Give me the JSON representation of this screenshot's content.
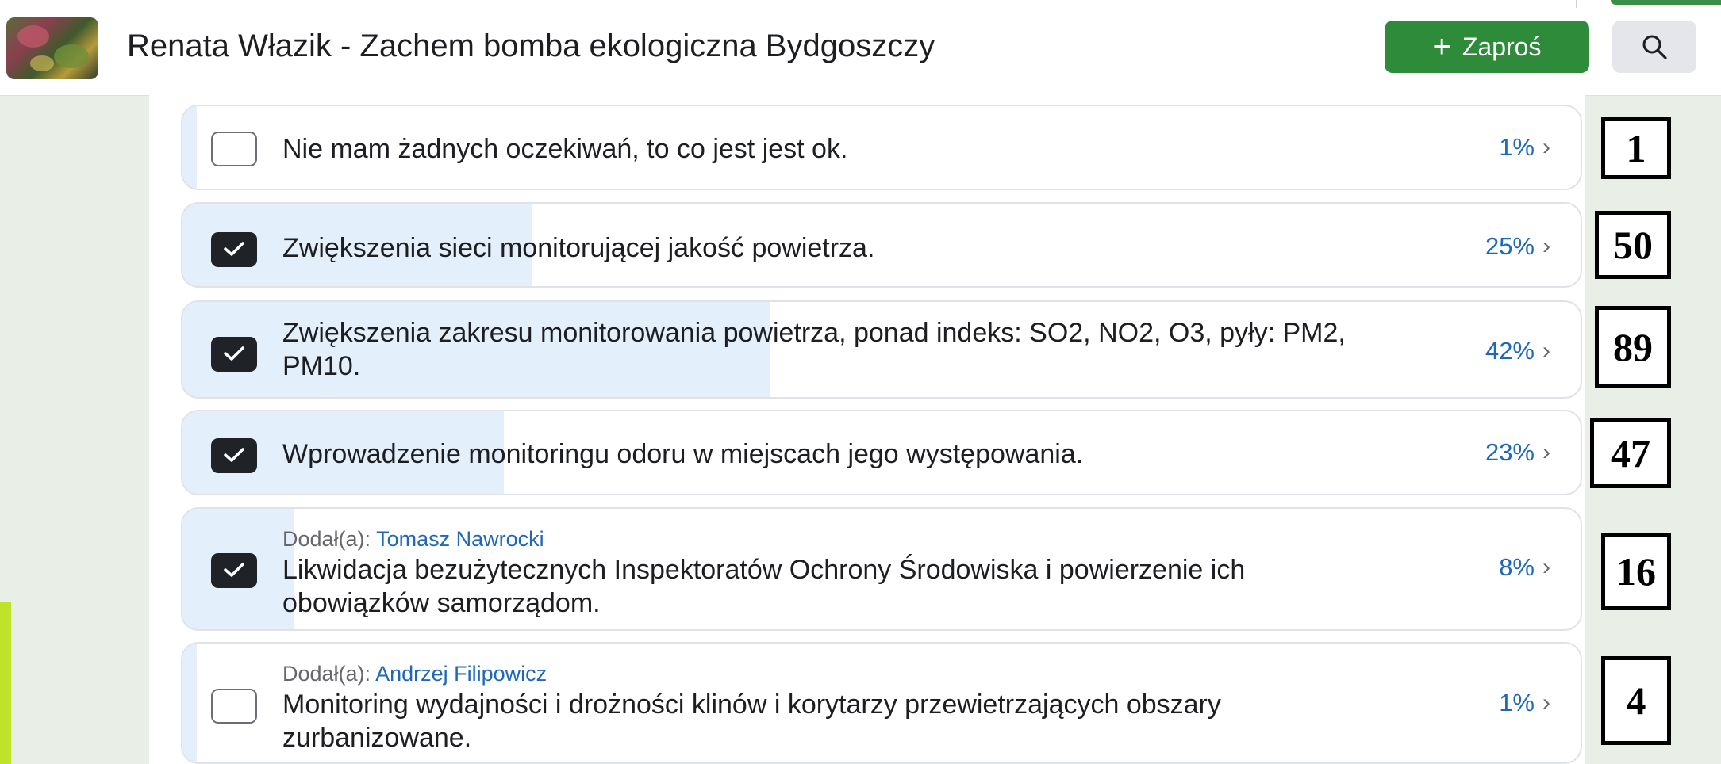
{
  "header": {
    "group_title": "Renata Włazik - Zachem bomba ekologiczna Bydgoszczy",
    "invite_label": "Zaproś",
    "invite_icon": "plus-icon",
    "search_icon": "search-icon",
    "invite_color": "#2e8b3a"
  },
  "poll": {
    "added_by_prefix": "Dodał(a):",
    "options": [
      {
        "text": "Nie mam żadnych oczekiwań, to co jest jest ok.",
        "percent": "1%",
        "percent_value": 1,
        "checked": false,
        "count": "1"
      },
      {
        "text": "Zwiększenia sieci monitorującej jakość powietrza.",
        "percent": "25%",
        "percent_value": 25,
        "checked": true,
        "count": "50"
      },
      {
        "text": "Zwiększenia zakresu monitorowania powietrza, ponad indeks: SO2, NO2, O3, pyły: PM2, PM10.",
        "percent": "42%",
        "percent_value": 42,
        "checked": true,
        "count": "89"
      },
      {
        "text": "Wprowadzenie monitoringu odoru w miejscach jego występowania.",
        "percent": "23%",
        "percent_value": 23,
        "checked": true,
        "count": "47"
      },
      {
        "added_by": "Tomasz Nawrocki",
        "text": "Likwidacja bezużytecznych Inspektoratów Ochrony Środowiska i powierzenie ich obowiązków samorządom.",
        "percent": "8%",
        "percent_value": 8,
        "checked": true,
        "count": "16"
      },
      {
        "added_by": "Andrzej Filipowicz",
        "text": "Monitoring wydajności i drożności klinów i korytarzy przewietrzających obszary zurbanizowane.",
        "percent": "1%",
        "percent_value": 1,
        "checked": false,
        "count": "4"
      }
    ]
  },
  "colors": {
    "percent_text": "#1f68b9",
    "bar_fill": "#e3effb",
    "checkbox_checked": "#1f2328",
    "accent": "#bfe22a"
  }
}
